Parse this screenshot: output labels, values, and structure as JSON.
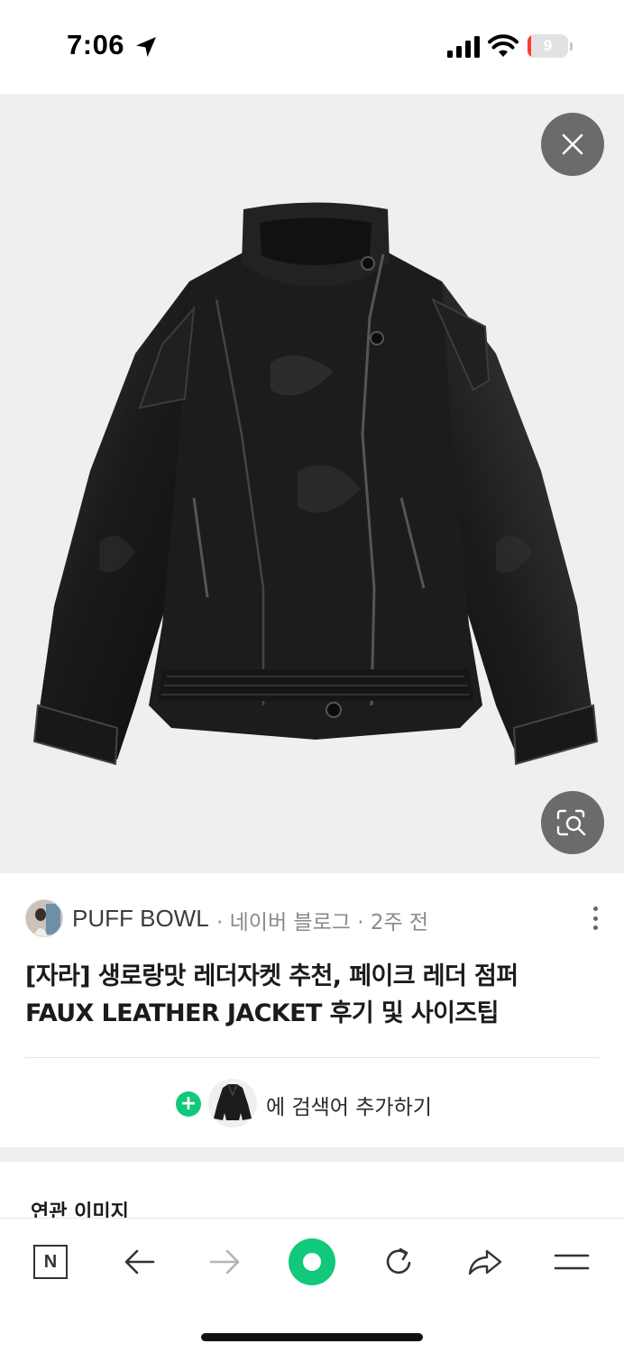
{
  "status_bar": {
    "time": "7:06",
    "battery_level": "9",
    "battery_fraction": 0.09,
    "icons": [
      "location-arrow-icon",
      "cellular-signal-icon",
      "wifi-icon",
      "battery-icon"
    ]
  },
  "viewer": {
    "image_subject": "black faux leather jacket",
    "close_icon": "close-icon",
    "lens_icon": "image-search-icon"
  },
  "source": {
    "name": "PUFF BOWL",
    "meta": "· 네이버 블로그 · 2주 전",
    "more_icon": "more-vertical-icon"
  },
  "post": {
    "title_line1": "[자라] 생로랑맛 레더자켓 추천, 페이크 레더 점퍼",
    "title_line2": "FAUX LEATHER JACKET 후기 및 사이즈팁"
  },
  "add_search": {
    "label": "에 검색어 추가하기",
    "icon": "plus-icon"
  },
  "related": {
    "title": "연관 이미지"
  },
  "toolbar": {
    "home_label": "N",
    "items": [
      "naver-home-icon",
      "back-arrow-icon",
      "forward-arrow-icon",
      "green-dot-button",
      "refresh-icon",
      "share-icon",
      "menu-icon"
    ]
  },
  "colors": {
    "accent_green": "#12c87a",
    "image_background": "#efefef",
    "button_gray": "#6b6b6b",
    "battery_red": "#ff3b30"
  }
}
